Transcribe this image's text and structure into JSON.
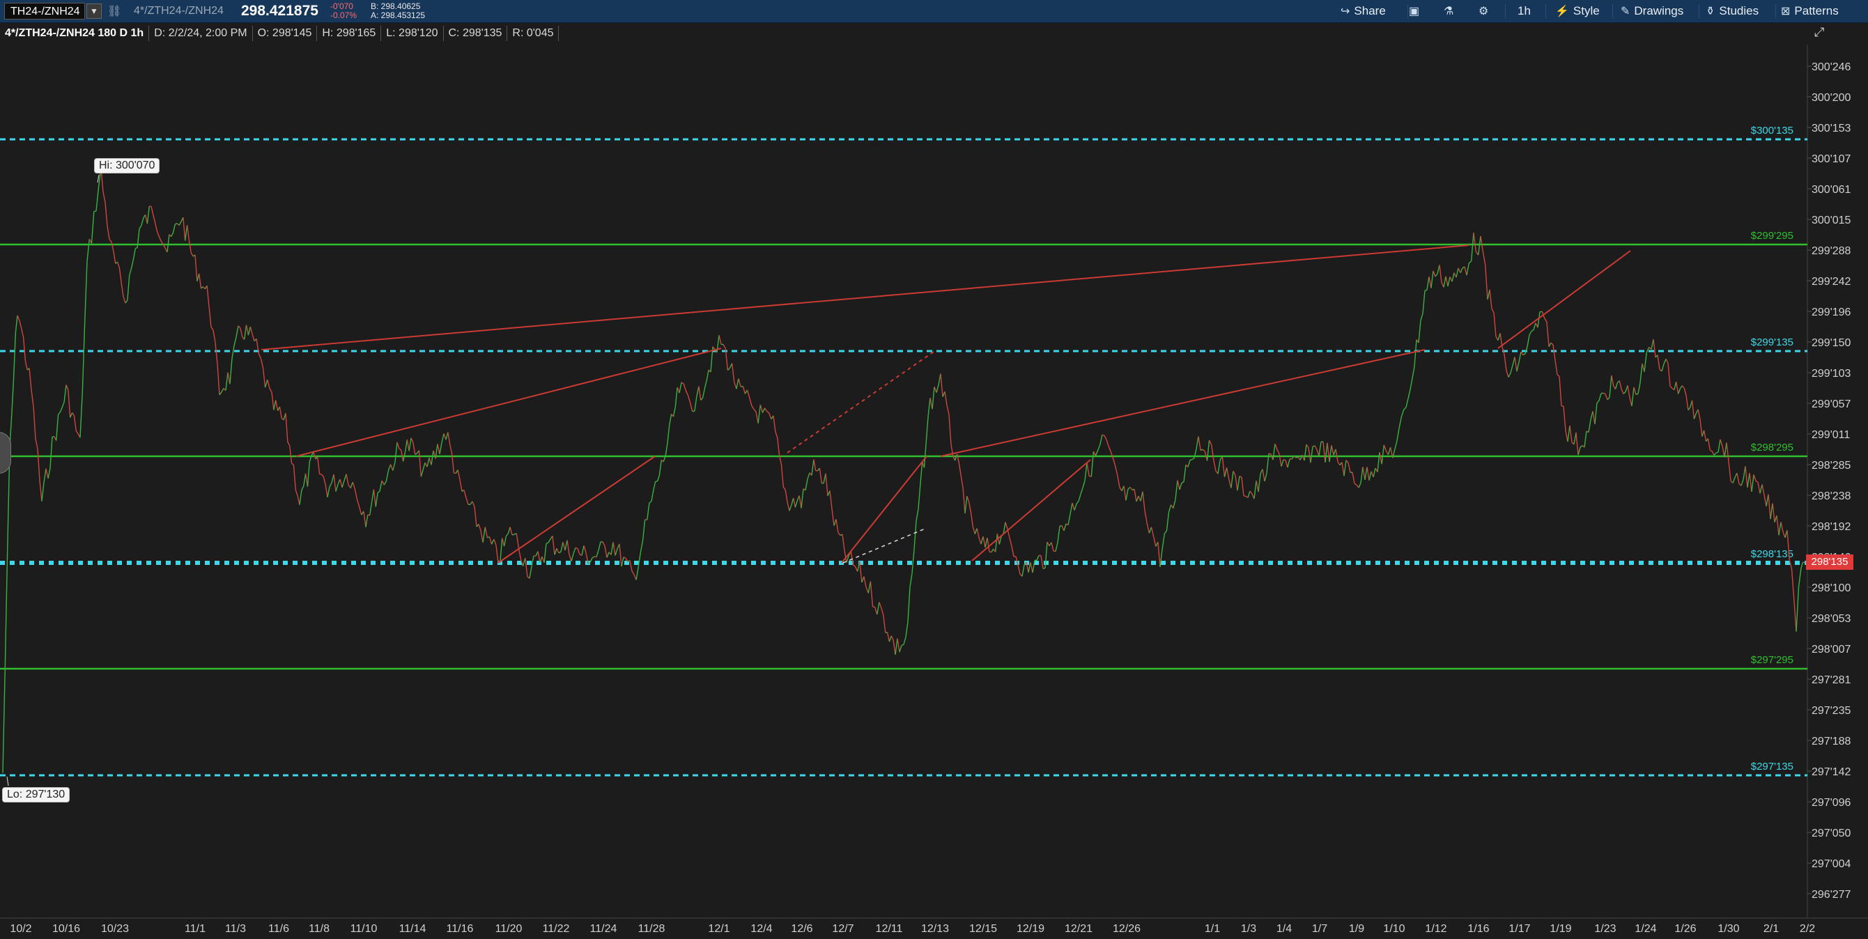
{
  "toolbar": {
    "symbol": "TH24-/ZNH24",
    "symbol_dropdown_icon": "chevron-down-icon",
    "link_icon": "link-icon",
    "description": "4*/ZTH24-/ZNH24",
    "last_price": "298.421875",
    "net_change": "-0'070",
    "percent_change": "-0.07%",
    "bid": "B: 298.40625",
    "ask": "A: 298.453125",
    "buttons": [
      {
        "label": "Share",
        "icon": "share-icon"
      },
      {
        "label": "",
        "icon": "screenshot-icon"
      },
      {
        "label": "",
        "icon": "flask-icon"
      },
      {
        "label": "",
        "icon": "gear-icon"
      },
      {
        "label": "1h",
        "icon": ""
      },
      {
        "label": "Style",
        "icon": "style-icon"
      },
      {
        "label": "Drawings",
        "icon": "drawings-icon"
      },
      {
        "label": "Studies",
        "icon": "studies-icon"
      },
      {
        "label": "Patterns",
        "icon": "patterns-icon"
      }
    ]
  },
  "info_strip": {
    "title": "4*/ZTH24-/ZNH24 180 D 1h",
    "date": "D: 2/2/24, 2:00 PM",
    "open": "O: 298'145",
    "high": "H: 298'165",
    "low": "L: 298'120",
    "close": "C: 298'135",
    "range": "R: 0'045"
  },
  "chart_data": {
    "type": "line",
    "y_axis_labels": [
      "300'246",
      "300'200",
      "300'153",
      "300'107",
      "300'061",
      "300'015",
      "299'288",
      "299'242",
      "299'196",
      "299'150",
      "299'103",
      "299'057",
      "299'011",
      "298'285",
      "298'238",
      "298'192",
      "298'146",
      "298'100",
      "298'053",
      "298'007",
      "297'281",
      "297'235",
      "297'188",
      "297'142",
      "297'096",
      "297'050",
      "297'004",
      "296'277"
    ],
    "x_axis_labels": [
      "10/2",
      "10/16",
      "10/23",
      "11/1",
      "11/3",
      "11/6",
      "11/8",
      "11/10",
      "11/14",
      "11/16",
      "11/20",
      "11/22",
      "11/24",
      "11/28",
      "12/1",
      "12/4",
      "12/6",
      "12/7",
      "12/11",
      "12/13",
      "12/15",
      "12/19",
      "12/21",
      "12/26",
      "1/1",
      "1/3",
      "1/4",
      "1/7",
      "1/9",
      "1/10",
      "1/12",
      "1/16",
      "1/17",
      "1/19",
      "1/23",
      "1/24",
      "1/26",
      "1/30",
      "2/1",
      "2/2"
    ],
    "current_price_label": "298'135",
    "high_label": "Hi: 300'070",
    "low_label": "Lo: 297'130",
    "horizontal_levels": [
      {
        "label": "$300'135",
        "style": "dashed",
        "color": "#3fd8e8"
      },
      {
        "label": "$299'295",
        "style": "solid",
        "color": "#2fbf2f"
      },
      {
        "label": "$299'135",
        "style": "dashed",
        "color": "#3fd8e8"
      },
      {
        "label": "$298'295",
        "style": "solid",
        "color": "#2fbf2f"
      },
      {
        "label": "$298'135",
        "style": "dotted",
        "color": "#3fd8e8"
      },
      {
        "label": "$297'295",
        "style": "solid",
        "color": "#2fbf2f"
      },
      {
        "label": "$297'135",
        "style": "dashed",
        "color": "#3fd8e8"
      }
    ],
    "colors": {
      "up": "#3cb043",
      "down": "#d0463e",
      "trendline": "#cc3b33",
      "background": "#1c1c1c"
    }
  }
}
